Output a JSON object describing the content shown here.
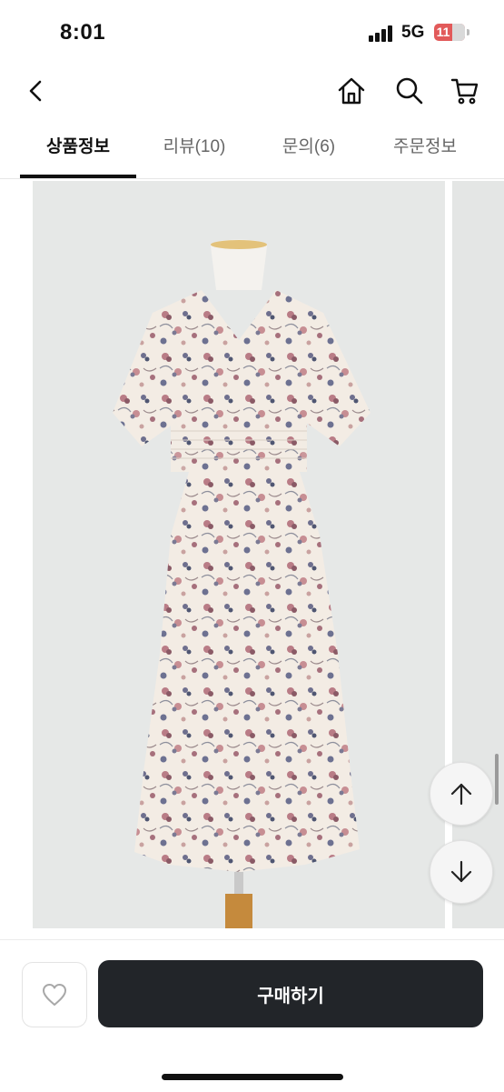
{
  "status": {
    "time": "8:01",
    "network": "5G",
    "battery": "11"
  },
  "nav": {
    "back_icon": "chevron-left-icon",
    "home_icon": "home-icon",
    "search_icon": "search-icon",
    "cart_icon": "cart-icon"
  },
  "tabs": [
    {
      "label": "상품정보",
      "active": true
    },
    {
      "label": "리뷰(10)",
      "active": false
    },
    {
      "label": "문의(6)",
      "active": false
    },
    {
      "label": "주문정보",
      "active": false
    }
  ],
  "scroll_buttons": {
    "up_icon": "arrow-up-icon",
    "down_icon": "arrow-down-icon"
  },
  "bottom": {
    "like_icon": "heart-icon",
    "buy_label": "구매하기"
  },
  "colors": {
    "buy_button": "#222529",
    "battery": "#e25a5a",
    "image_background": "#e6e8e7"
  }
}
